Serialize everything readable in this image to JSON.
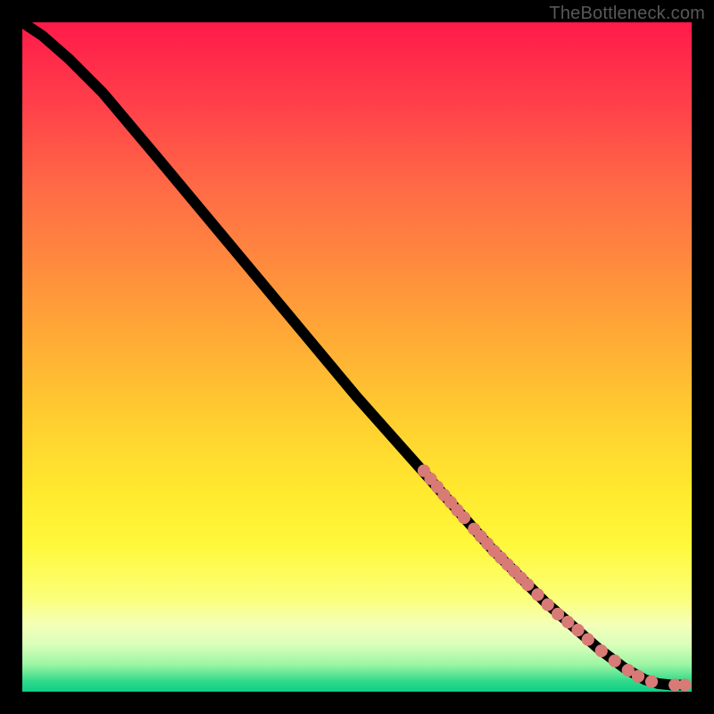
{
  "attribution": "TheBottleneck.com",
  "chart_data": {
    "type": "line",
    "title": "",
    "xlabel": "",
    "ylabel": "",
    "xlim": [
      0,
      100
    ],
    "ylim": [
      0,
      100
    ],
    "grid": false,
    "curve": [
      {
        "x": 0,
        "y": 100
      },
      {
        "x": 3,
        "y": 98
      },
      {
        "x": 7,
        "y": 94.5
      },
      {
        "x": 12,
        "y": 89.5
      },
      {
        "x": 20,
        "y": 80
      },
      {
        "x": 30,
        "y": 68
      },
      {
        "x": 40,
        "y": 56
      },
      {
        "x": 50,
        "y": 44
      },
      {
        "x": 58,
        "y": 35
      },
      {
        "x": 62,
        "y": 30.5
      },
      {
        "x": 66,
        "y": 26
      },
      {
        "x": 70,
        "y": 21.5
      },
      {
        "x": 74,
        "y": 17.5
      },
      {
        "x": 78,
        "y": 13.5
      },
      {
        "x": 82,
        "y": 10
      },
      {
        "x": 86,
        "y": 6.5
      },
      {
        "x": 90,
        "y": 3.5
      },
      {
        "x": 93,
        "y": 1.8
      },
      {
        "x": 95,
        "y": 1.2
      },
      {
        "x": 97,
        "y": 1.0
      },
      {
        "x": 99,
        "y": 1.0
      }
    ],
    "markers": [
      {
        "x": 60.0,
        "y": 33.0
      },
      {
        "x": 61.0,
        "y": 31.8
      },
      {
        "x": 62.0,
        "y": 30.6
      },
      {
        "x": 63.0,
        "y": 29.4
      },
      {
        "x": 64.0,
        "y": 28.3
      },
      {
        "x": 65.0,
        "y": 27.1
      },
      {
        "x": 66.0,
        "y": 26.0
      },
      {
        "x": 67.5,
        "y": 24.3
      },
      {
        "x": 68.5,
        "y": 23.2
      },
      {
        "x": 69.5,
        "y": 22.1
      },
      {
        "x": 70.5,
        "y": 21.0
      },
      {
        "x": 71.5,
        "y": 20.0
      },
      {
        "x": 72.5,
        "y": 19.0
      },
      {
        "x": 73.5,
        "y": 18.0
      },
      {
        "x": 74.5,
        "y": 17.0
      },
      {
        "x": 75.5,
        "y": 16.0
      },
      {
        "x": 77.0,
        "y": 14.5
      },
      {
        "x": 78.5,
        "y": 13.0
      },
      {
        "x": 80.0,
        "y": 11.6
      },
      {
        "x": 81.5,
        "y": 10.4
      },
      {
        "x": 83.0,
        "y": 9.2
      },
      {
        "x": 84.5,
        "y": 7.8
      },
      {
        "x": 86.5,
        "y": 6.1
      },
      {
        "x": 88.5,
        "y": 4.6
      },
      {
        "x": 90.5,
        "y": 3.2
      },
      {
        "x": 92.0,
        "y": 2.3
      },
      {
        "x": 94.0,
        "y": 1.5
      },
      {
        "x": 97.5,
        "y": 1.0
      },
      {
        "x": 99.0,
        "y": 1.0
      }
    ],
    "marker_radius_pct": 0.95,
    "marker_color": "#d87a76"
  }
}
